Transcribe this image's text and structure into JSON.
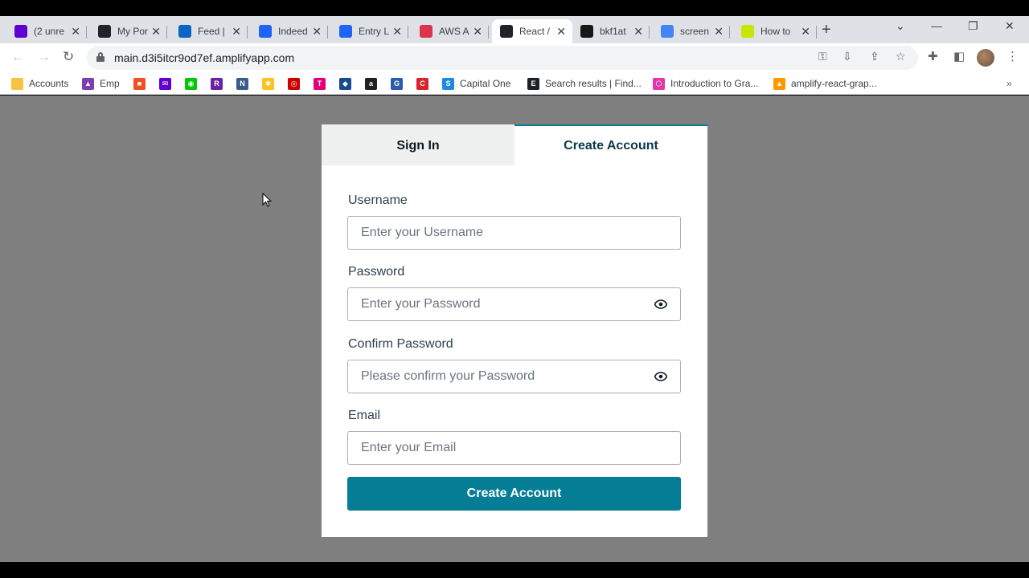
{
  "browser": {
    "tabs": [
      {
        "label": "(2 unre",
        "icon": "mail-icon",
        "color": "#6001d2"
      },
      {
        "label": "My Por",
        "icon": "react-icon",
        "color": "#20232a"
      },
      {
        "label": "Feed |",
        "icon": "linkedin-icon",
        "color": "#0a66c2"
      },
      {
        "label": "Indeed",
        "icon": "indeed-icon",
        "color": "#2164f3"
      },
      {
        "label": "Entry L",
        "icon": "indeed-icon",
        "color": "#2164f3"
      },
      {
        "label": "AWS A",
        "icon": "aws-icon",
        "color": "#dd344c"
      },
      {
        "label": "React /",
        "icon": "react-icon",
        "color": "#20232a"
      },
      {
        "label": "bkf1at",
        "icon": "github-icon",
        "color": "#181717"
      },
      {
        "label": "screen",
        "icon": "google-icon",
        "color": "#4285f4"
      },
      {
        "label": "How to",
        "icon": "bt-icon",
        "color": "#c8e600"
      }
    ],
    "url": "main.d3i5itcr9od7ef.amplifyapp.com",
    "bookmarks": [
      {
        "label": "Accounts",
        "icon": "folder-icon",
        "color": "#f6c344",
        "glyph": ""
      },
      {
        "label": "Emp",
        "icon": "emp-icon",
        "color": "#7b3fb2",
        "glyph": "▲"
      },
      {
        "label": "",
        "icon": "microsoft-icon",
        "color": "#f25022",
        "glyph": "■"
      },
      {
        "label": "",
        "icon": "yahoo-mail-icon",
        "color": "#6001d2",
        "glyph": "✉"
      },
      {
        "label": "",
        "icon": "robinhood-icon",
        "color": "#00c805",
        "glyph": "◉"
      },
      {
        "label": "",
        "icon": "r-icon",
        "color": "#6b21a8",
        "glyph": "R"
      },
      {
        "label": "",
        "icon": "n-icon",
        "color": "#3b5b8c",
        "glyph": "N"
      },
      {
        "label": "",
        "icon": "walmart-icon",
        "color": "#ffc220",
        "glyph": "✱"
      },
      {
        "label": "",
        "icon": "target-icon",
        "color": "#cc0000",
        "glyph": "◎"
      },
      {
        "label": "",
        "icon": "tmobile-icon",
        "color": "#e20074",
        "glyph": "T"
      },
      {
        "label": "",
        "icon": "bank-icon",
        "color": "#1a4b8c",
        "glyph": "◆"
      },
      {
        "label": "",
        "icon": "amazon-icon",
        "color": "#222222",
        "glyph": "a"
      },
      {
        "label": "",
        "icon": "g-icon",
        "color": "#2a5db0",
        "glyph": "G"
      },
      {
        "label": "",
        "icon": "c-icon",
        "color": "#d8232a",
        "glyph": "C"
      },
      {
        "label": "Capital One",
        "icon": "capital-one-icon",
        "color": "#1e88e5",
        "glyph": "S"
      },
      {
        "label": "Search results | Find...",
        "icon": "search-results-icon",
        "color": "#1d2226",
        "glyph": "E"
      },
      {
        "label": "Introduction to Gra...",
        "icon": "graphql-icon",
        "color": "#e535ab",
        "glyph": "⬡"
      },
      {
        "label": "amplify-react-grap...",
        "icon": "amplify-icon",
        "color": "#ff9900",
        "glyph": "▲"
      }
    ]
  },
  "auth": {
    "tabs": {
      "sign_in": "Sign In",
      "create_account": "Create Account"
    },
    "username": {
      "label": "Username",
      "placeholder": "Enter your Username"
    },
    "password": {
      "label": "Password",
      "placeholder": "Enter your Password"
    },
    "confirm_password": {
      "label": "Confirm Password",
      "placeholder": "Please confirm your Password"
    },
    "email": {
      "label": "Email",
      "placeholder": "Enter your Email"
    },
    "submit_label": "Create Account",
    "accent_color": "#047d95"
  }
}
